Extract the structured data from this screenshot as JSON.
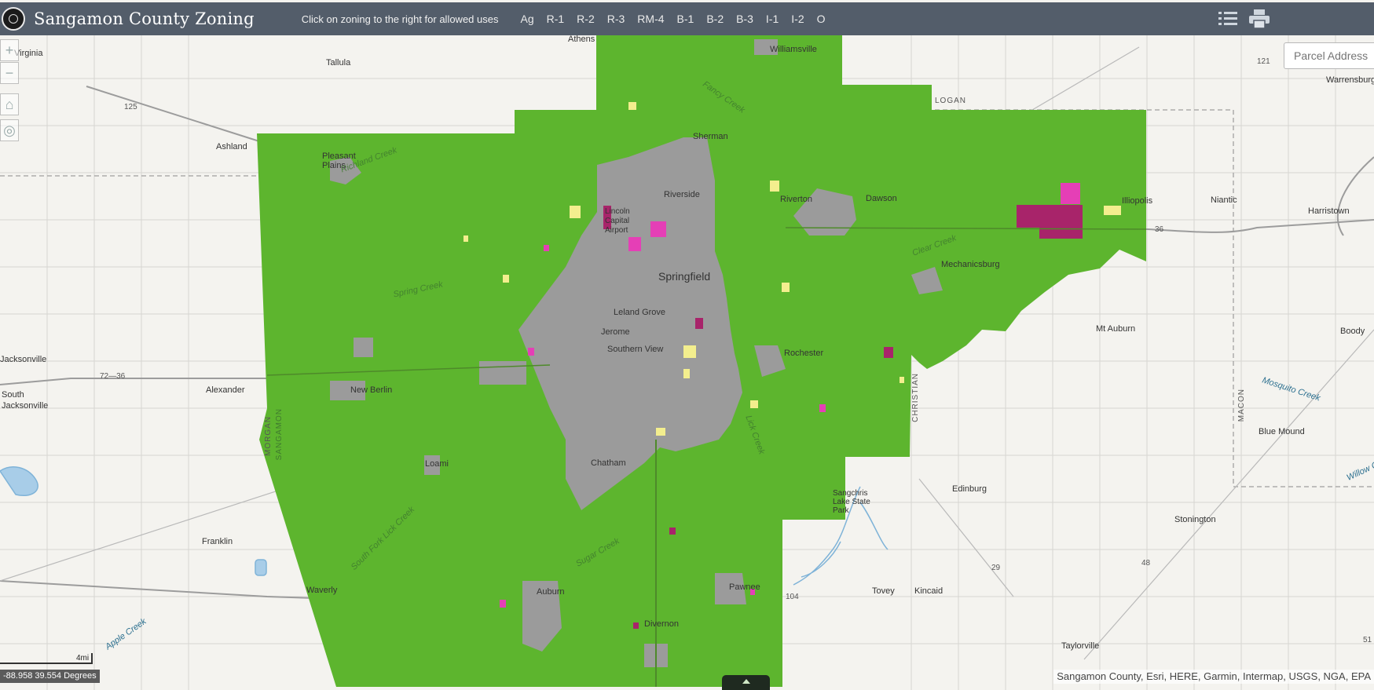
{
  "header": {
    "title": "Sangamon County Zoning",
    "subtitle": "Click on zoning to the right for allowed uses",
    "zones": [
      "Ag",
      "R-1",
      "R-2",
      "R-3",
      "RM-4",
      "B-1",
      "B-2",
      "B-3",
      "I-1",
      "I-2",
      "O"
    ],
    "icons": [
      "list-icon",
      "print-icon"
    ]
  },
  "search": {
    "placeholder": "Parcel Address"
  },
  "colors": {
    "agriculture": "#5db52e",
    "urban": "#9b9b9b",
    "residential": "#f3ee8e",
    "business": "#e53fb6",
    "industrial": "#a8246a",
    "water": "#a8cde8",
    "header": "#535d6a"
  },
  "map": {
    "places": {
      "virginia": "Virginia",
      "tallula": "Tallula",
      "athens": "Athens",
      "williamsville": "Williamsville",
      "logan": "LOGAN",
      "warrensburg": "Warrensburg",
      "ashland": "Ashland",
      "pleasant_plains": "Pleasant Plains",
      "sherman": "Sherman",
      "riverside": "Riverside",
      "riverton": "Riverton",
      "dawson": "Dawson",
      "illiopolis": "Illiopolis",
      "niantic": "Niantic",
      "harristown": "Harristown",
      "airport": "Lincoln Capital Airport",
      "springfield": "Springfield",
      "mechanicsburg": "Mechanicsburg",
      "leland_grove": "Leland Grove",
      "jerome": "Jerome",
      "southern_view": "Southern View",
      "rochester": "Rochester",
      "mt_auburn": "Mt Auburn",
      "boody": "Boody",
      "jacksonville": "Jacksonville",
      "alexander": "Alexander",
      "new_berlin": "New Berlin",
      "south_jacksonville": "South Jacksonville",
      "morgan": "MORGAN",
      "sangamon": "SANGAMON",
      "christian": "CHRISTIAN",
      "macon": "MACON",
      "blue_mound": "Blue Mound",
      "loami": "Loami",
      "chatham": "Chatham",
      "edinburg": "Edinburg",
      "sangchris": "Sangchris Lake State Park",
      "stonington": "Stonington",
      "franklin": "Franklin",
      "waverly": "Waverly",
      "auburn": "Auburn",
      "pawnee": "Pawnee",
      "tovey": "Tovey",
      "kincaid": "Kincaid",
      "divernon": "Divernon",
      "taylorville": "Taylorville"
    },
    "water_labels": {
      "richland_creek": "Richland Creek",
      "spring_creek": "Spring Creek",
      "clear_creek": "Clear Creek",
      "mosquito_creek": "Mosquito Creek",
      "south_fork": "South Fork Lick Creek",
      "sugar_creek": "Sugar Creek",
      "apple_creek": "Apple Creek",
      "fancy_creek": "Fancy Creek",
      "willow_creek": "Willow Creek",
      "lick_creek": "Lick Creek"
    },
    "routes": {
      "r125": "125",
      "r36": "36",
      "r72_36": "72—36",
      "r104": "104",
      "r48": "48",
      "r29": "29",
      "r121": "121",
      "r51": "51"
    },
    "scale_label": "4mi",
    "coordinates": "-88.958 39.554 Degrees",
    "attribution": "Sangamon County, Esri, HERE, Garmin, Intermap, USGS, NGA, EPA"
  }
}
